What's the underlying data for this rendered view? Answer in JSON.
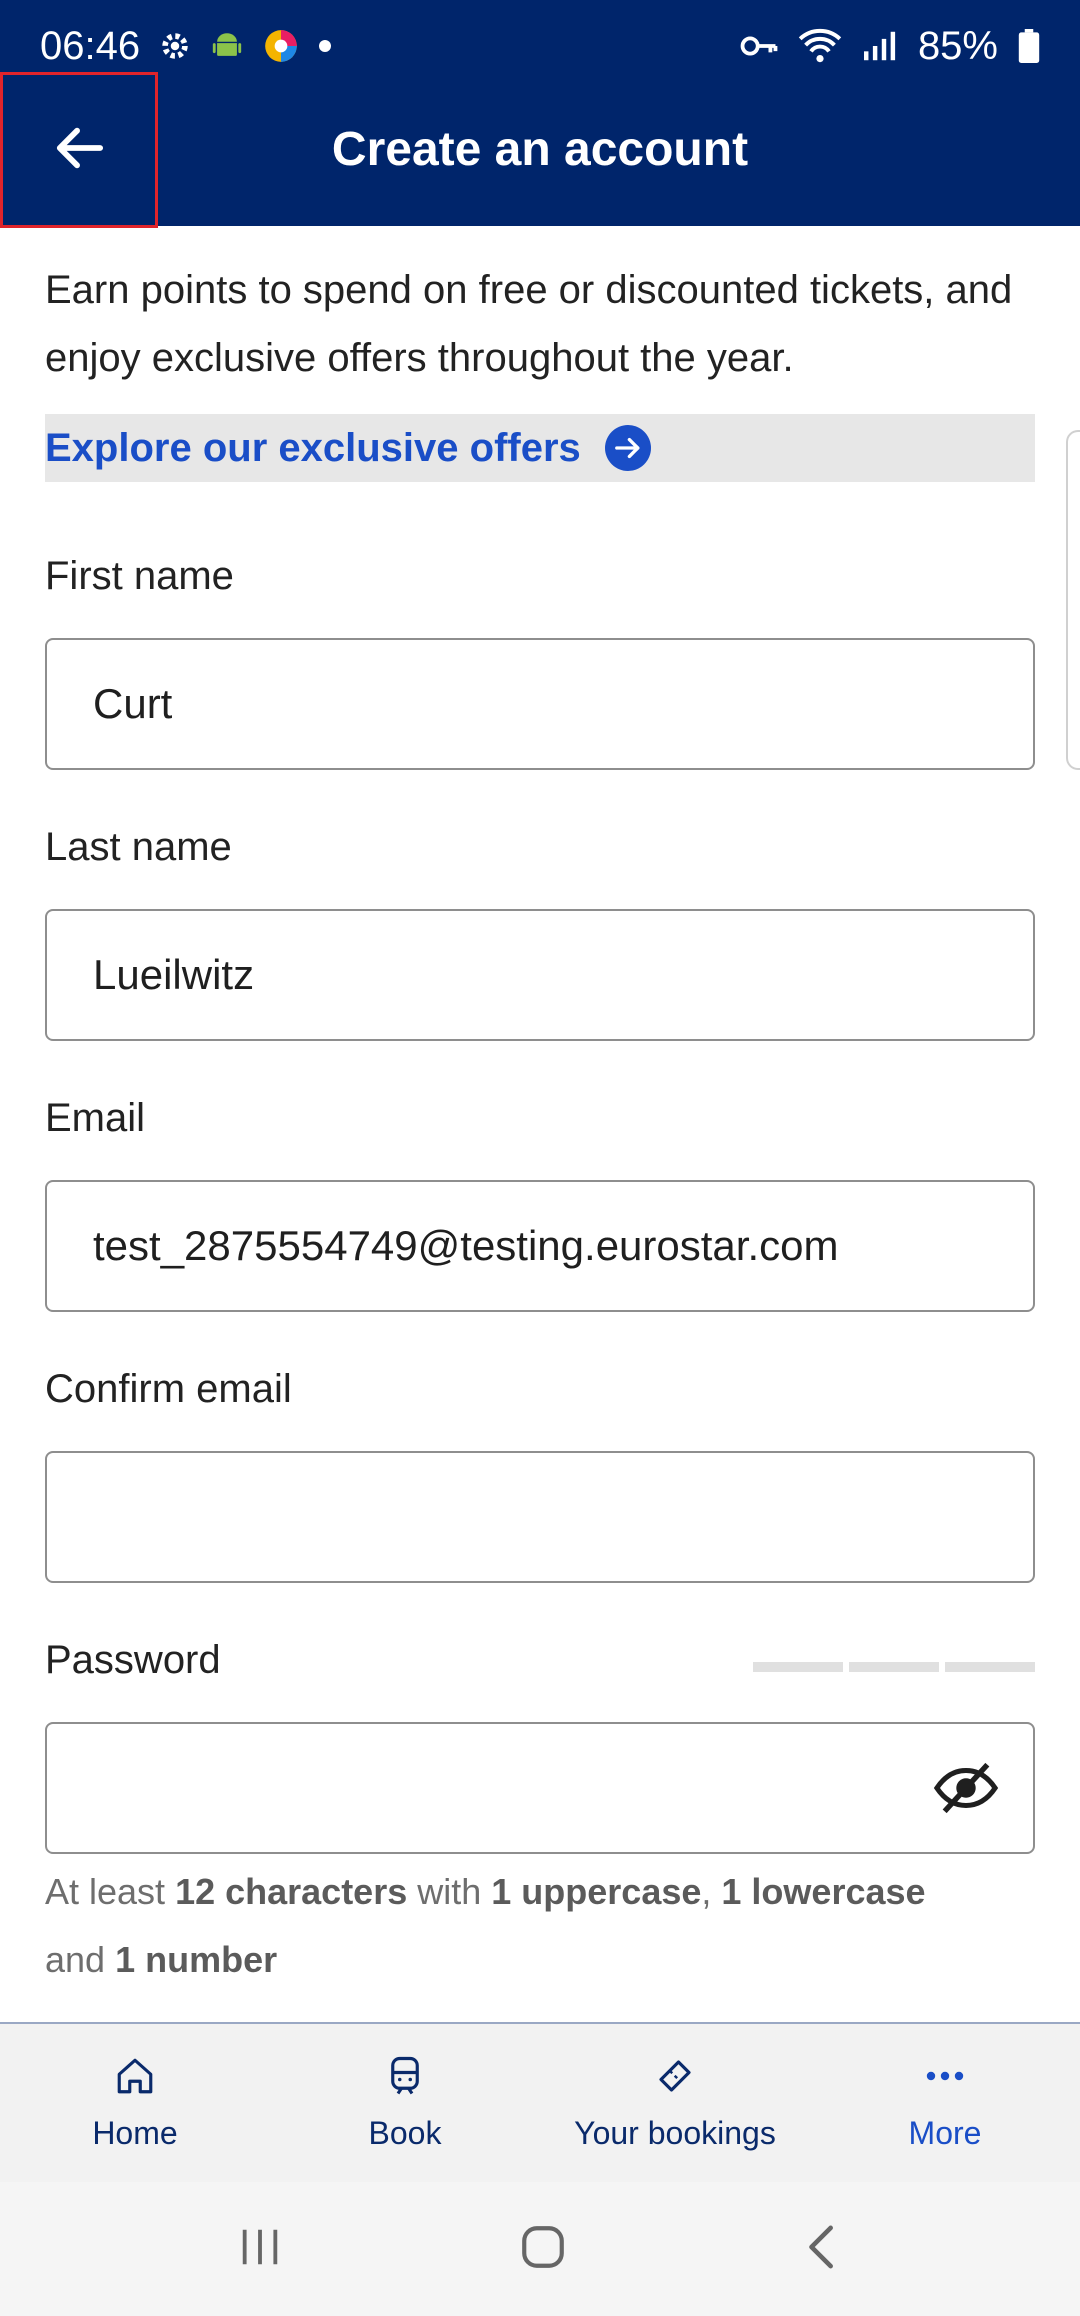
{
  "status_bar": {
    "time": "06:46",
    "battery": "85%",
    "icons": [
      "settings-icon",
      "android-icon",
      "browser-icon",
      "dot-icon",
      "key-icon",
      "wifi-icon",
      "signal-icon",
      "battery-icon"
    ]
  },
  "app_bar": {
    "title": "Create an account",
    "back_icon": "arrow-left-icon"
  },
  "intro_text": "Earn points to spend on free or discounted tickets, and enjoy exclusive offers throughout the year.",
  "offers_link": "Explore our exclusive offers",
  "form": {
    "first_name": {
      "label": "First name",
      "value": "Curt"
    },
    "last_name": {
      "label": "Last name",
      "value": "Lueilwitz"
    },
    "email": {
      "label": "Email",
      "value": "test_2875554749@testing.eurostar.com"
    },
    "confirm_email": {
      "label": "Confirm email",
      "value": ""
    },
    "password": {
      "label": "Password",
      "value": ""
    }
  },
  "password_hint": {
    "p1": "At least ",
    "b1": "12 characters",
    "p2": " with ",
    "b2": "1 uppercase",
    "p3": ", ",
    "b3": "1 lowercase",
    "p4": "and ",
    "b4": "1 number"
  },
  "bottom_nav": [
    {
      "label": "Home",
      "icon": "home-icon"
    },
    {
      "label": "Book",
      "icon": "train-icon"
    },
    {
      "label": "Your bookings",
      "icon": "ticket-icon"
    },
    {
      "label": "More",
      "icon": "more-dots-icon"
    }
  ],
  "colors": {
    "primary_navy": "#00256b",
    "link_blue": "#1a4ec7",
    "highlight_red": "#e0242b"
  }
}
